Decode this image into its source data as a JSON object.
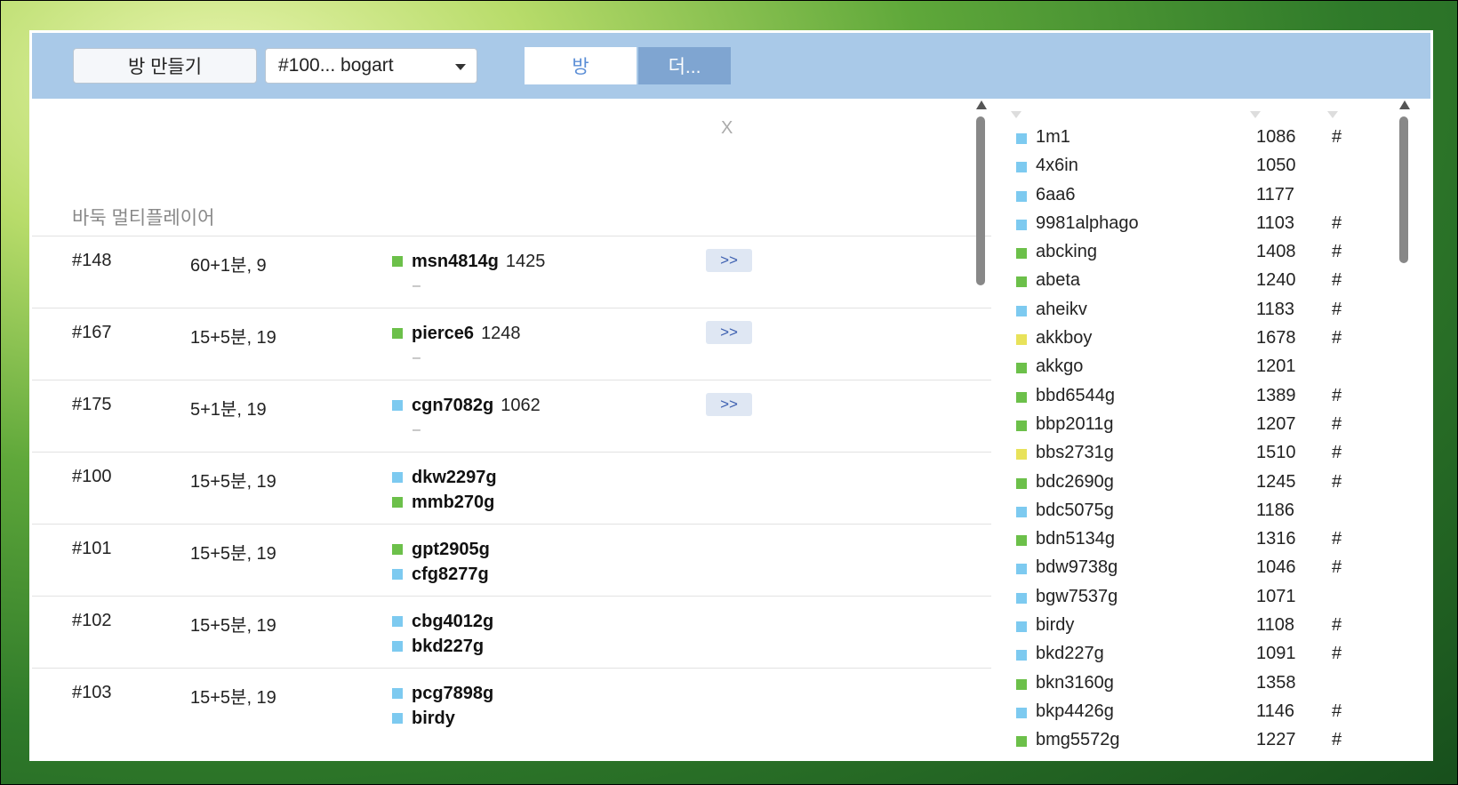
{
  "toolbar": {
    "create_room_label": "방 만들기",
    "room_select_value": "#100... bogart",
    "tab_room_label": "방",
    "tab_more_label": "더..."
  },
  "left": {
    "close_label": "X",
    "section_title": "바둑 멀티플레이어",
    "join_label": ">>",
    "dash": "–"
  },
  "colors": {
    "green": "#6cc04a",
    "blue": "#7dcaf0",
    "yellow": "#e8e25a"
  },
  "rooms": [
    {
      "id": "#148",
      "time": "60+1분, 9",
      "players": [
        {
          "name": "msn4814g",
          "rating": "1425",
          "color": "green"
        }
      ],
      "waiting": true
    },
    {
      "id": "#167",
      "time": "15+5분, 19",
      "players": [
        {
          "name": "pierce6",
          "rating": "1248",
          "color": "green"
        }
      ],
      "waiting": true
    },
    {
      "id": "#175",
      "time": "5+1분, 19",
      "players": [
        {
          "name": "cgn7082g",
          "rating": "1062",
          "color": "blue"
        }
      ],
      "waiting": true
    },
    {
      "id": "#100",
      "time": "15+5분, 19",
      "players": [
        {
          "name": "dkw2297g",
          "color": "blue"
        },
        {
          "name": "mmb270g",
          "color": "green"
        }
      ]
    },
    {
      "id": "#101",
      "time": "15+5분, 19",
      "players": [
        {
          "name": "gpt2905g",
          "color": "green"
        },
        {
          "name": "cfg8277g",
          "color": "blue"
        }
      ]
    },
    {
      "id": "#102",
      "time": "15+5분, 19",
      "players": [
        {
          "name": "cbg4012g",
          "color": "blue"
        },
        {
          "name": "bkd227g",
          "color": "blue"
        }
      ]
    },
    {
      "id": "#103",
      "time": "15+5분, 19",
      "players": [
        {
          "name": "pcg7898g",
          "color": "blue"
        },
        {
          "name": "birdy",
          "color": "blue"
        }
      ]
    }
  ],
  "users": [
    {
      "name": "1m1",
      "rating": "1086",
      "hash": "#",
      "color": "blue"
    },
    {
      "name": "4x6in",
      "rating": "1050",
      "hash": "",
      "color": "blue"
    },
    {
      "name": "6aa6",
      "rating": "1177",
      "hash": "",
      "color": "blue"
    },
    {
      "name": "9981alphago",
      "rating": "1103",
      "hash": "#",
      "color": "blue"
    },
    {
      "name": "abcking",
      "rating": "1408",
      "hash": "#",
      "color": "green"
    },
    {
      "name": "abeta",
      "rating": "1240",
      "hash": "#",
      "color": "green"
    },
    {
      "name": "aheikv",
      "rating": "1183",
      "hash": "#",
      "color": "blue"
    },
    {
      "name": "akkboy",
      "rating": "1678",
      "hash": "#",
      "color": "yellow"
    },
    {
      "name": "akkgo",
      "rating": "1201",
      "hash": "",
      "color": "green"
    },
    {
      "name": "bbd6544g",
      "rating": "1389",
      "hash": "#",
      "color": "green"
    },
    {
      "name": "bbp2011g",
      "rating": "1207",
      "hash": "#",
      "color": "green"
    },
    {
      "name": "bbs2731g",
      "rating": "1510",
      "hash": "#",
      "color": "yellow"
    },
    {
      "name": "bdc2690g",
      "rating": "1245",
      "hash": "#",
      "color": "green"
    },
    {
      "name": "bdc5075g",
      "rating": "1186",
      "hash": "",
      "color": "blue"
    },
    {
      "name": "bdn5134g",
      "rating": "1316",
      "hash": "#",
      "color": "green"
    },
    {
      "name": "bdw9738g",
      "rating": "1046",
      "hash": "#",
      "color": "blue"
    },
    {
      "name": "bgw7537g",
      "rating": "1071",
      "hash": "",
      "color": "blue"
    },
    {
      "name": "birdy",
      "rating": "1108",
      "hash": "#",
      "color": "blue"
    },
    {
      "name": "bkd227g",
      "rating": "1091",
      "hash": "#",
      "color": "blue"
    },
    {
      "name": "bkn3160g",
      "rating": "1358",
      "hash": "",
      "color": "green"
    },
    {
      "name": "bkp4426g",
      "rating": "1146",
      "hash": "#",
      "color": "blue"
    },
    {
      "name": "bmg5572g",
      "rating": "1227",
      "hash": "#",
      "color": "green"
    }
  ]
}
